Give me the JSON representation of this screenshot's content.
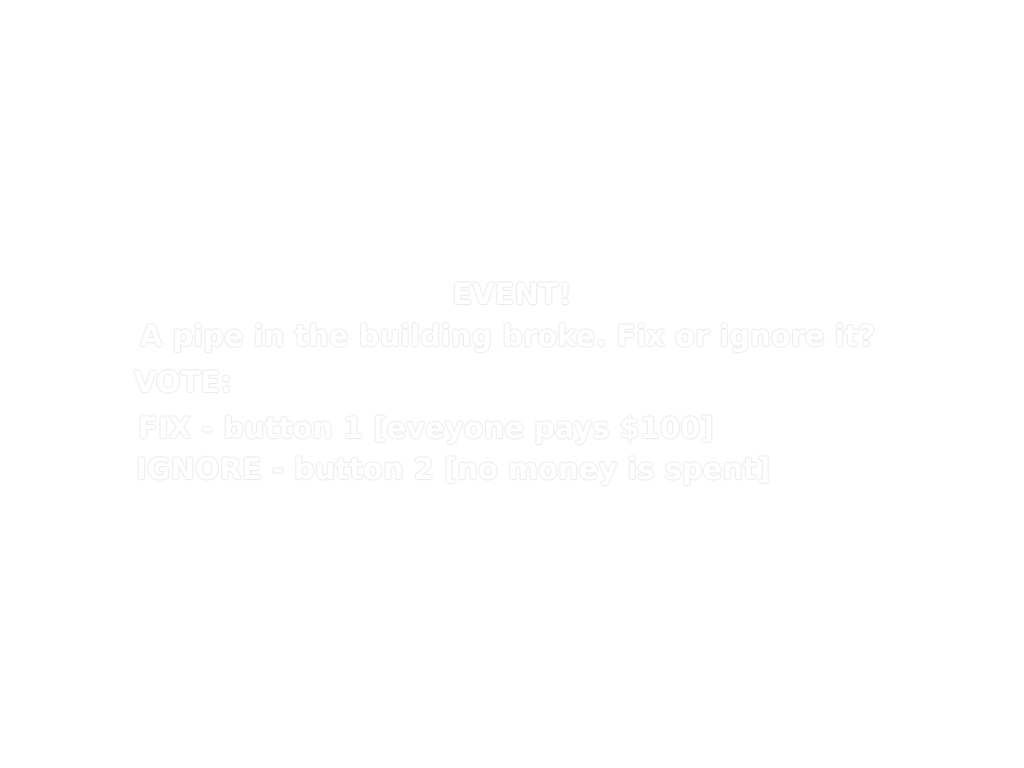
{
  "event": {
    "title": "EVENT!",
    "question": "A pipe in the building broke.  Fix or ignore it?",
    "vote_label": "VOTE:",
    "options": [
      {
        "label": "FIX - button 1 [eveyone pays $100]"
      },
      {
        "label": "IGNORE - button 2 [no money is spent]"
      }
    ]
  },
  "colors": {
    "background": "#ffffff",
    "text": "#ffffff"
  }
}
